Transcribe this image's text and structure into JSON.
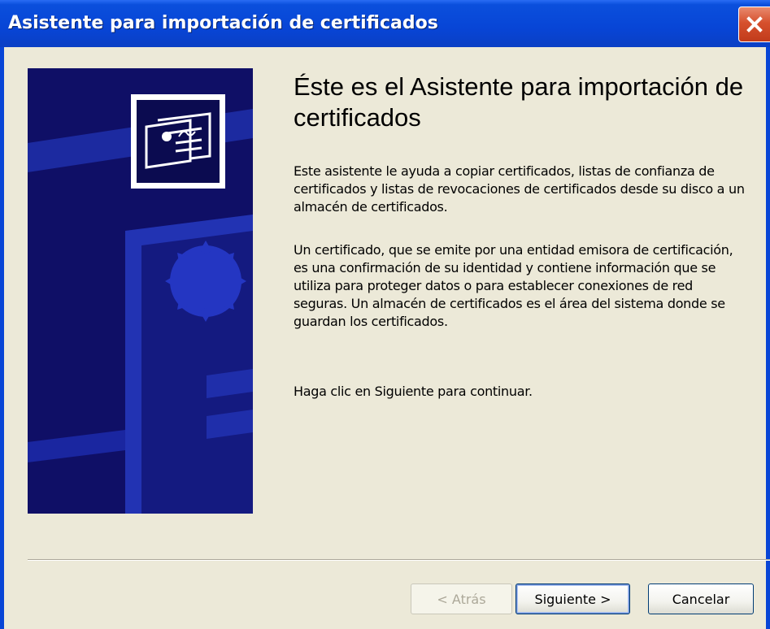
{
  "window": {
    "title": "Asistente para importación de certificados"
  },
  "icons": {
    "close": "close-icon",
    "banner": "certificate-illustration"
  },
  "colors": {
    "titlebar": "#0845d6",
    "banner_bg": "#0f0f66",
    "banner_shapes": "#1f2ea8",
    "dialog_bg": "#ece9d8"
  },
  "content": {
    "heading": "Éste es el Asistente para importación de certificados",
    "paragraph_1": "Este asistente le ayuda a copiar certificados, listas de confianza de certificados y listas de revocaciones de certificados desde su disco a un almacén de certificados.",
    "paragraph_2": "Un certificado, que se emite por una entidad emisora de certificación, es una confirmación de su identidad y contiene información que se utiliza para proteger datos o para establecer conexiones de red seguras. Un almacén de certificados es el área del sistema donde se guardan los certificados.",
    "paragraph_3": "Haga clic en Siguiente para continuar."
  },
  "buttons": {
    "back": "< Atrás",
    "next": "Siguiente >",
    "cancel": "Cancelar"
  }
}
